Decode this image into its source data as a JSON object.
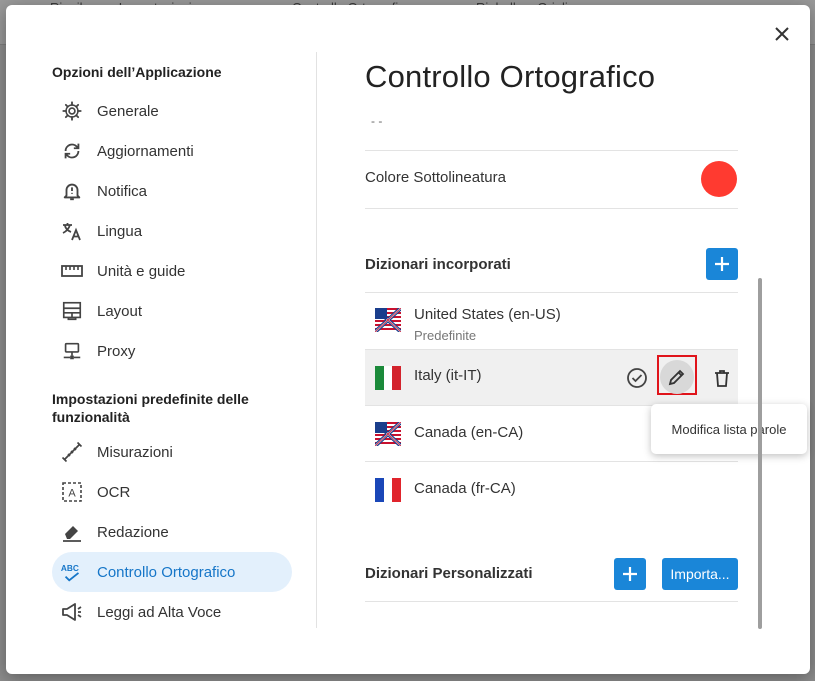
{
  "background_tabs": [
    "Riepilogo e Impostazioni",
    "Controllo Ortografico",
    "Righello e Griglie"
  ],
  "close_label": "×",
  "sidebar": {
    "section1_title": "Opzioni dell’Applicazione",
    "items1": [
      {
        "label": "Generale",
        "icon": "gear-icon"
      },
      {
        "label": "Aggiornamenti",
        "icon": "sync-icon"
      },
      {
        "label": "Notifica",
        "icon": "bell-alert-icon"
      },
      {
        "label": "Lingua",
        "icon": "translate-icon"
      },
      {
        "label": "Unità e guide",
        "icon": "ruler-icon"
      },
      {
        "label": "Layout",
        "icon": "layout-icon"
      },
      {
        "label": "Proxy",
        "icon": "proxy-icon"
      }
    ],
    "section2_title": "Impostazioni predefinite delle funzionalità",
    "items2": [
      {
        "label": "Misurazioni",
        "icon": "measure-icon"
      },
      {
        "label": "OCR",
        "icon": "ocr-icon"
      },
      {
        "label": "Redazione",
        "icon": "eraser-icon"
      },
      {
        "label": "Controllo Ortografico",
        "icon": "spellcheck-icon",
        "active": true
      },
      {
        "label": "Leggi ad Alta Voce",
        "icon": "megaphone-icon"
      }
    ]
  },
  "main": {
    "title": "Controllo Ortografico",
    "truncated_text": "- -",
    "underline_color_label": "Colore Sottolineatura",
    "underline_color": "#ff3a30",
    "builtin_title": "Dizionari incorporati",
    "dictionaries": [
      {
        "name": "United States (en-US)",
        "sub": "Predefinite",
        "flag": "us-uk-flag"
      },
      {
        "name": "Italy (it-IT)",
        "sub": "",
        "flag": "italy-flag"
      },
      {
        "name": "Canada (en-CA)",
        "sub": "",
        "flag": "us-uk-flag"
      },
      {
        "name": "Canada (fr-CA)",
        "sub": "",
        "flag": "france-flag"
      }
    ],
    "tooltip": "Modifica lista parole",
    "custom_title": "Dizionari Personalizzati",
    "import_label": "Importa..."
  },
  "colors": {
    "accent": "#1a86d8",
    "active_bg": "#e3f0fc",
    "active_text": "#1676c8",
    "highlight": "#e0141b"
  }
}
